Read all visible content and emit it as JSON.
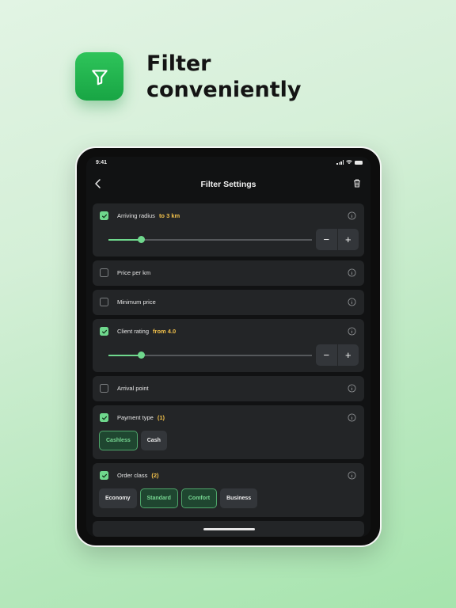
{
  "hero": {
    "title_line1": "Filter",
    "title_line2": "conveniently",
    "icon": "filter-funnel-icon",
    "brand_color": "#22b34f"
  },
  "status_bar": {
    "time": "9:41"
  },
  "header": {
    "title": "Filter Settings"
  },
  "accent_color": "#6fd88d",
  "highlight_color": "#f2c14b",
  "filters": {
    "arriving_radius": {
      "label": "Arriving radius",
      "value": "to 3 km",
      "checked": true
    },
    "price_per_km": {
      "label": "Price per km",
      "checked": false
    },
    "minimum_price": {
      "label": "Minimum price",
      "checked": false
    },
    "client_rating": {
      "label": "Client rating",
      "value": "from 4.0",
      "checked": true
    },
    "arrival_point": {
      "label": "Arrival point",
      "checked": false
    },
    "payment_type": {
      "label": "Payment type",
      "count": "(1)",
      "checked": true,
      "options": [
        {
          "label": "Cashless",
          "selected": true
        },
        {
          "label": "Cash",
          "selected": false
        }
      ]
    },
    "order_class": {
      "label": "Order class",
      "count": "(2)",
      "checked": true,
      "options": [
        {
          "label": "Economy",
          "selected": false
        },
        {
          "label": "Standard",
          "selected": true
        },
        {
          "label": "Comfort",
          "selected": true
        },
        {
          "label": "Business",
          "selected": false
        }
      ]
    }
  },
  "stepper": {
    "minus": "−",
    "plus": "+"
  }
}
